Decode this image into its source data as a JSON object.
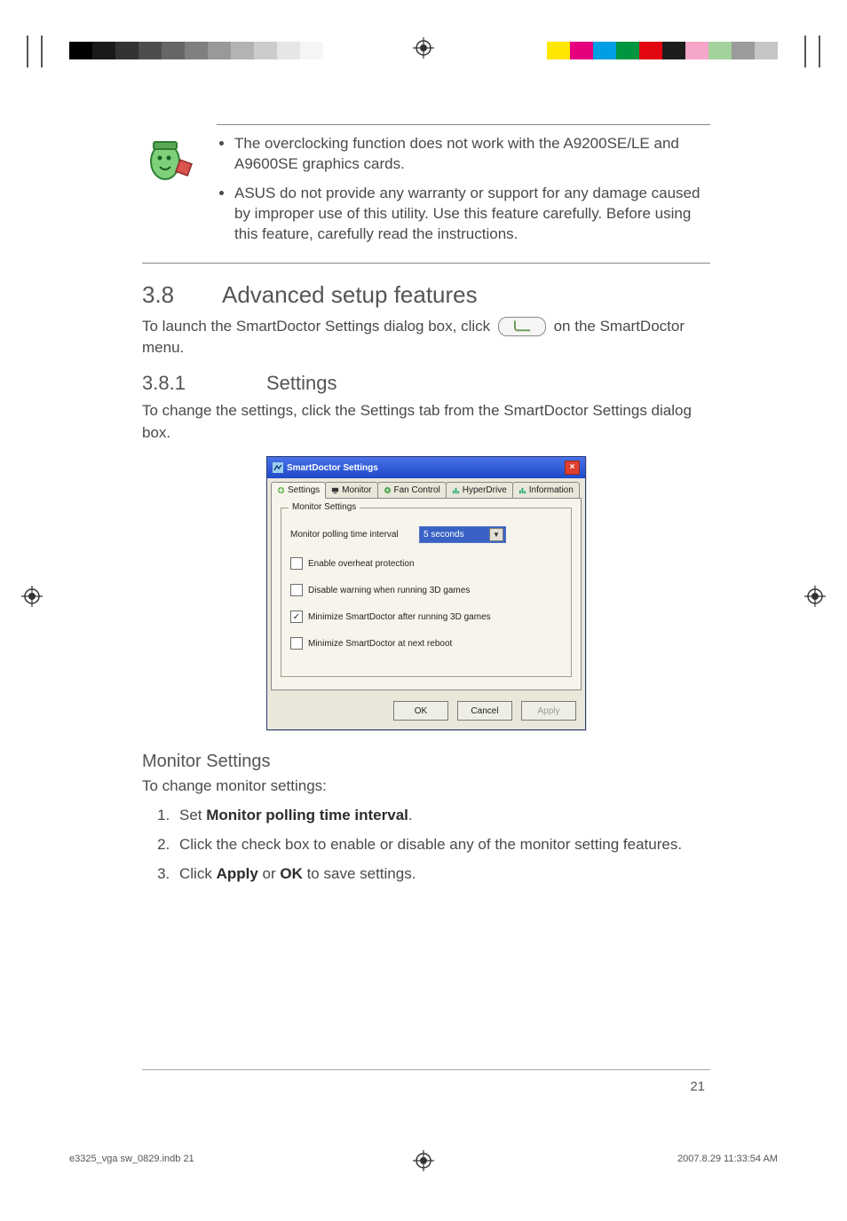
{
  "notes": {
    "items": [
      "The overclocking function does not work with the A9200SE/LE and A9600SE graphics cards.",
      "ASUS do not provide any warranty or support for any damage caused by improper use of this utility. Use this feature carefully. Before using this feature, carefully read the instructions."
    ]
  },
  "section": {
    "number": "3.8",
    "title": "Advanced setup features",
    "intro_before": "To launch the SmartDoctor Settings dialog box, click ",
    "intro_after": " on the SmartDoctor menu."
  },
  "subsection": {
    "number": "3.8.1",
    "title": "Settings",
    "intro": "To change the settings, click the Settings tab from the SmartDoctor Settings dialog box."
  },
  "dialog": {
    "title": "SmartDoctor Settings",
    "tabs": [
      "Settings",
      "Monitor",
      "Fan Control",
      "HyperDrive",
      "Information"
    ],
    "group_legend": "Monitor Settings",
    "polling_label": "Monitor polling time interval",
    "polling_value": "5 seconds",
    "checkboxes": [
      {
        "label": "Enable overheat protection",
        "checked": false
      },
      {
        "label": "Disable warning when running 3D games",
        "checked": false
      },
      {
        "label": "Minimize SmartDoctor after running 3D games",
        "checked": true
      },
      {
        "label": "Minimize SmartDoctor at next reboot",
        "checked": false
      }
    ],
    "buttons": {
      "ok": "OK",
      "cancel": "Cancel",
      "apply": "Apply"
    }
  },
  "monitor_settings": {
    "heading": "Monitor Settings",
    "intro": "To change monitor settings:",
    "step1_prefix": "Set ",
    "step1_bold": "Monitor polling time interval",
    "step1_suffix": ".",
    "step2": "Click the check box to enable or disable any of the monitor setting features.",
    "step3_prefix": "Click ",
    "step3_bold1": "Apply",
    "step3_mid": " or ",
    "step3_bold2": "OK",
    "step3_suffix": " to save settings."
  },
  "page_number": "21",
  "print_footer": {
    "left": "e3325_vga sw_0829.indb   21",
    "right": "2007.8.29   11:33:54 AM"
  }
}
